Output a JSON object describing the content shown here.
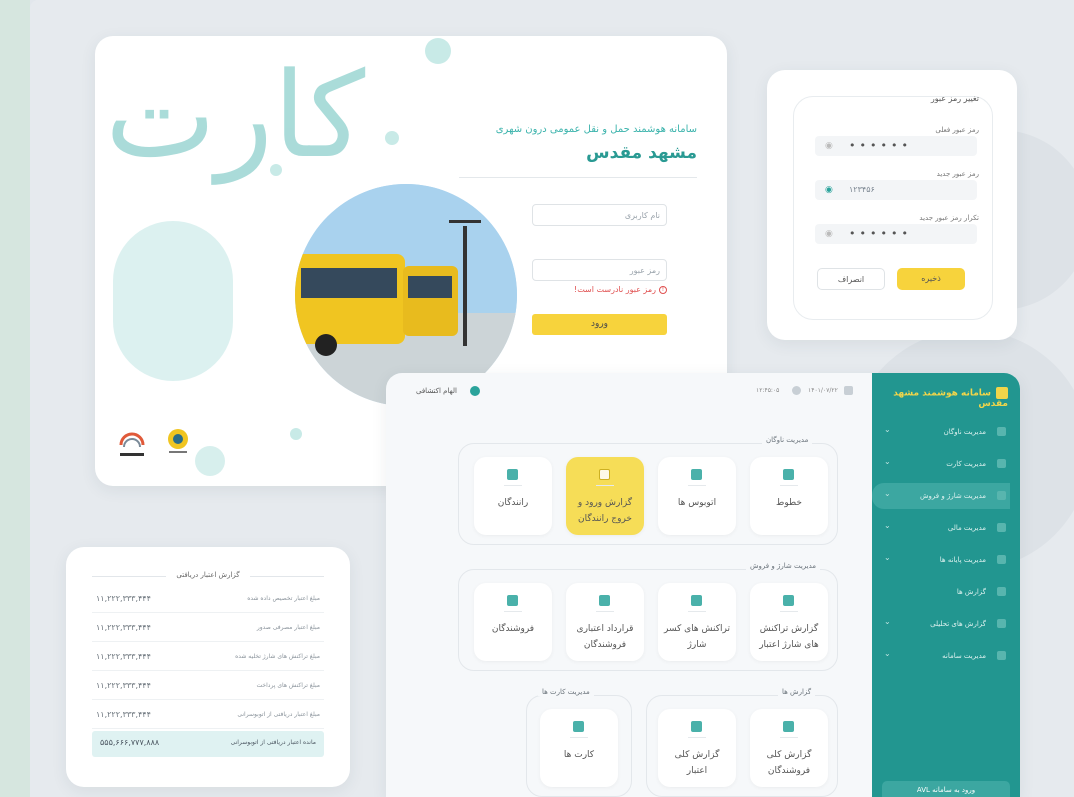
{
  "login": {
    "brand": "کارت",
    "subtitle": "سامانه هوشمند حمل و نقل عمومی درون شهری",
    "city": "مشهد مقدس",
    "username_placeholder": "نام کاربری",
    "password_placeholder": "رمز عبور",
    "error": "رمز عبور نادرست است!",
    "submit": "ورود"
  },
  "password_change": {
    "title": "تغییر رمز عبور",
    "current_label": "رمز عبور فعلی",
    "current_value": "••••••",
    "new_label": "رمز عبور جدید",
    "new_value": "۱۲۳۴۵۶",
    "repeat_label": "تکرار رمز عبور جدید",
    "repeat_value": "••••••",
    "save": "ذخیره",
    "cancel": "انصراف"
  },
  "report": {
    "title": "گزارش اعتبار دریافتی",
    "rows": [
      {
        "label": "مبلغ اعتبار تخصیص داده شده",
        "value": "۱۱,۲۲۲,۳۳۳,۴۴۴"
      },
      {
        "label": "مبلغ اعتبار مصرفی صدور",
        "value": "۱۱,۲۲۲,۳۳۳,۴۴۴"
      },
      {
        "label": "مبلغ تراکنش های شارژ تخلیه شده",
        "value": "۱۱,۲۲۲,۳۳۳,۴۴۴"
      },
      {
        "label": "مبلغ تراکنش های پرداخت",
        "value": "۱۱,۲۲۲,۳۳۳,۴۴۴"
      },
      {
        "label": "مبلغ اعتبار دریافتی از اتوبوسرانی",
        "value": "۱۱,۲۲۲,۳۳۳,۴۴۴"
      }
    ],
    "total_label": "مانده اعتبار دریافتی از اتوبوسرانی",
    "total_value": "۵۵۵,۶۶۶,۷۷۷,۸۸۸"
  },
  "dashboard": {
    "app_title": "سامانه هوشمند مشهد مقدس",
    "user": "الهام اکتشافی",
    "date": "۱۴۰۱/۰۷/۲۲",
    "time": "۱۲:۴۵:۰۵",
    "sidebar": [
      {
        "label": "مدیریت ناوگان"
      },
      {
        "label": "مدیریت کارت"
      },
      {
        "label": "مدیریت شارژ و فروش"
      },
      {
        "label": "مدیریت مالی"
      },
      {
        "label": "مدیریت پایانه ها"
      },
      {
        "label": "گزارش ها"
      },
      {
        "label": "گزارش های تحلیلی"
      },
      {
        "label": "مدیریت سامانه"
      }
    ],
    "sidebar_footer": "ورود به سامانه AVL",
    "sections": {
      "fleet": {
        "title": "مدیریت ناوگان",
        "tiles": [
          "خطوط",
          "اتوبوس ها",
          "گزارش ورود و خروج رانندگان",
          "رانندگان"
        ]
      },
      "charge": {
        "title": "مدیریت شارژ و فروش",
        "tiles": [
          "گزارش تراکنش های شارژ اعتبار",
          "تراکنش های کسر شارژ",
          "قرارداد اعتباری فروشندگان",
          "فروشندگان"
        ]
      },
      "reports": {
        "title": "گزارش ها",
        "tiles": [
          "گزارش کلی فروشندگان",
          "گزارش کلی اعتبار"
        ]
      },
      "cards": {
        "title": "مدیریت کارت ها",
        "tiles": [
          "کارت ها"
        ]
      }
    }
  },
  "colors": {
    "teal": "#229690",
    "yellow": "#f7d33c",
    "error": "#e05050"
  }
}
